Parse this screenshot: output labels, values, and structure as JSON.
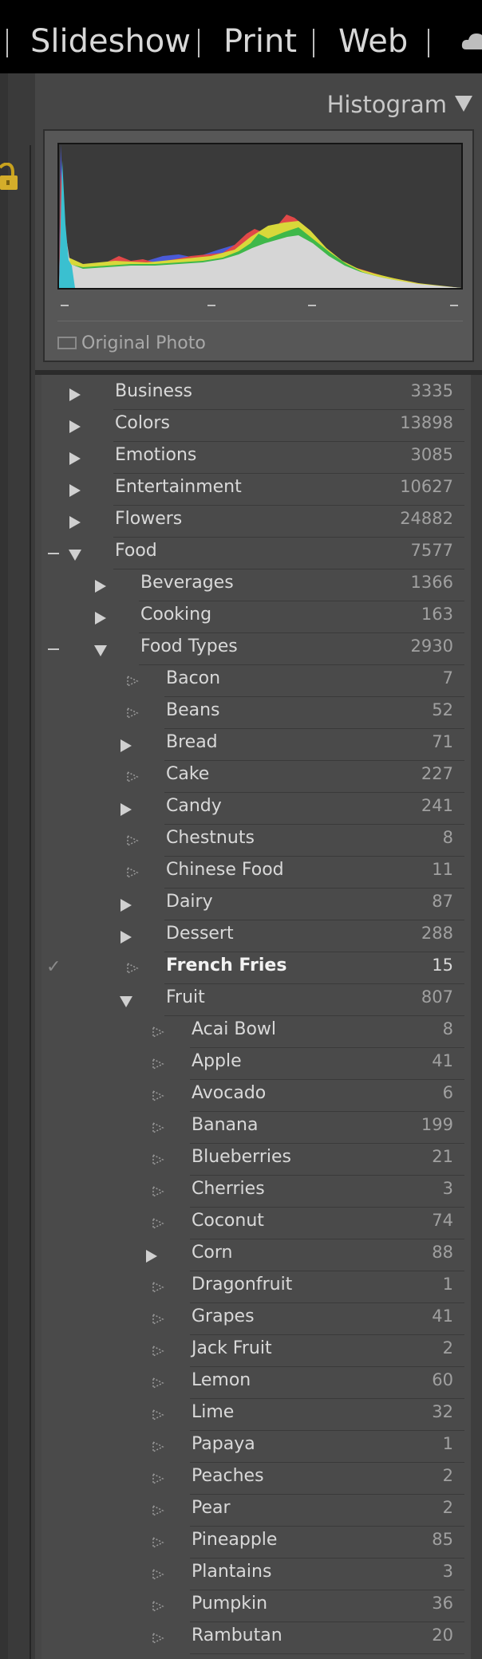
{
  "top_nav": {
    "modules": [
      "Slideshow",
      "Print",
      "Web"
    ]
  },
  "histogram": {
    "title": "Histogram",
    "original_photo_label": "Original Photo",
    "tick_marks": [
      "–",
      "–",
      "–",
      "–"
    ]
  },
  "keywords": [
    {
      "label": "Business",
      "count": "3335",
      "depth": 0,
      "state": "collapsed",
      "minus": false,
      "check": false
    },
    {
      "label": "Colors",
      "count": "13898",
      "depth": 0,
      "state": "collapsed",
      "minus": false,
      "check": false
    },
    {
      "label": "Emotions",
      "count": "3085",
      "depth": 0,
      "state": "collapsed",
      "minus": false,
      "check": false
    },
    {
      "label": "Entertainment",
      "count": "10627",
      "depth": 0,
      "state": "collapsed",
      "minus": false,
      "check": false
    },
    {
      "label": "Flowers",
      "count": "24882",
      "depth": 0,
      "state": "collapsed",
      "minus": false,
      "check": false
    },
    {
      "label": "Food",
      "count": "7577",
      "depth": 0,
      "state": "expanded",
      "minus": true,
      "check": false
    },
    {
      "label": "Beverages",
      "count": "1366",
      "depth": 1,
      "state": "collapsed",
      "minus": false,
      "check": false
    },
    {
      "label": "Cooking",
      "count": "163",
      "depth": 1,
      "state": "collapsed",
      "minus": false,
      "check": false
    },
    {
      "label": "Food Types",
      "count": "2930",
      "depth": 1,
      "state": "expanded",
      "minus": true,
      "check": false
    },
    {
      "label": "Bacon",
      "count": "7",
      "depth": 2,
      "state": "leaf",
      "minus": false,
      "check": false
    },
    {
      "label": "Beans",
      "count": "52",
      "depth": 2,
      "state": "leaf",
      "minus": false,
      "check": false
    },
    {
      "label": "Bread",
      "count": "71",
      "depth": 2,
      "state": "collapsed",
      "minus": false,
      "check": false
    },
    {
      "label": "Cake",
      "count": "227",
      "depth": 2,
      "state": "leaf",
      "minus": false,
      "check": false
    },
    {
      "label": "Candy",
      "count": "241",
      "depth": 2,
      "state": "collapsed",
      "minus": false,
      "check": false
    },
    {
      "label": "Chestnuts",
      "count": "8",
      "depth": 2,
      "state": "leaf",
      "minus": false,
      "check": false
    },
    {
      "label": "Chinese Food",
      "count": "11",
      "depth": 2,
      "state": "leaf",
      "minus": false,
      "check": false
    },
    {
      "label": "Dairy",
      "count": "87",
      "depth": 2,
      "state": "collapsed",
      "minus": false,
      "check": false
    },
    {
      "label": "Dessert",
      "count": "288",
      "depth": 2,
      "state": "collapsed",
      "minus": false,
      "check": false
    },
    {
      "label": "French Fries",
      "count": "15",
      "depth": 2,
      "state": "leaf",
      "minus": false,
      "check": true
    },
    {
      "label": "Fruit",
      "count": "807",
      "depth": 2,
      "state": "expanded",
      "minus": false,
      "check": false
    },
    {
      "label": "Acai Bowl",
      "count": "8",
      "depth": 3,
      "state": "leaf",
      "minus": false,
      "check": false
    },
    {
      "label": "Apple",
      "count": "41",
      "depth": 3,
      "state": "leaf",
      "minus": false,
      "check": false
    },
    {
      "label": "Avocado",
      "count": "6",
      "depth": 3,
      "state": "leaf",
      "minus": false,
      "check": false
    },
    {
      "label": "Banana",
      "count": "199",
      "depth": 3,
      "state": "leaf",
      "minus": false,
      "check": false
    },
    {
      "label": "Blueberries",
      "count": "21",
      "depth": 3,
      "state": "leaf",
      "minus": false,
      "check": false
    },
    {
      "label": "Cherries",
      "count": "3",
      "depth": 3,
      "state": "leaf",
      "minus": false,
      "check": false
    },
    {
      "label": "Coconut",
      "count": "74",
      "depth": 3,
      "state": "leaf",
      "minus": false,
      "check": false
    },
    {
      "label": "Corn",
      "count": "88",
      "depth": 3,
      "state": "collapsed",
      "minus": false,
      "check": false
    },
    {
      "label": "Dragonfruit",
      "count": "1",
      "depth": 3,
      "state": "leaf",
      "minus": false,
      "check": false
    },
    {
      "label": "Grapes",
      "count": "41",
      "depth": 3,
      "state": "leaf",
      "minus": false,
      "check": false
    },
    {
      "label": "Jack Fruit",
      "count": "2",
      "depth": 3,
      "state": "leaf",
      "minus": false,
      "check": false
    },
    {
      "label": "Lemon",
      "count": "60",
      "depth": 3,
      "state": "leaf",
      "minus": false,
      "check": false
    },
    {
      "label": "Lime",
      "count": "32",
      "depth": 3,
      "state": "leaf",
      "minus": false,
      "check": false
    },
    {
      "label": "Papaya",
      "count": "1",
      "depth": 3,
      "state": "leaf",
      "minus": false,
      "check": false
    },
    {
      "label": "Peaches",
      "count": "2",
      "depth": 3,
      "state": "leaf",
      "minus": false,
      "check": false
    },
    {
      "label": "Pear",
      "count": "2",
      "depth": 3,
      "state": "leaf",
      "minus": false,
      "check": false
    },
    {
      "label": "Pineapple",
      "count": "85",
      "depth": 3,
      "state": "leaf",
      "minus": false,
      "check": false
    },
    {
      "label": "Plantains",
      "count": "3",
      "depth": 3,
      "state": "leaf",
      "minus": false,
      "check": false
    },
    {
      "label": "Pumpkin",
      "count": "36",
      "depth": 3,
      "state": "leaf",
      "minus": false,
      "check": false
    },
    {
      "label": "Rambutan",
      "count": "20",
      "depth": 3,
      "state": "leaf",
      "minus": false,
      "check": false
    }
  ],
  "colors": {
    "panel_bg": "#464646",
    "text": "#d9d9d9",
    "count_text": "#a0a0a0"
  }
}
